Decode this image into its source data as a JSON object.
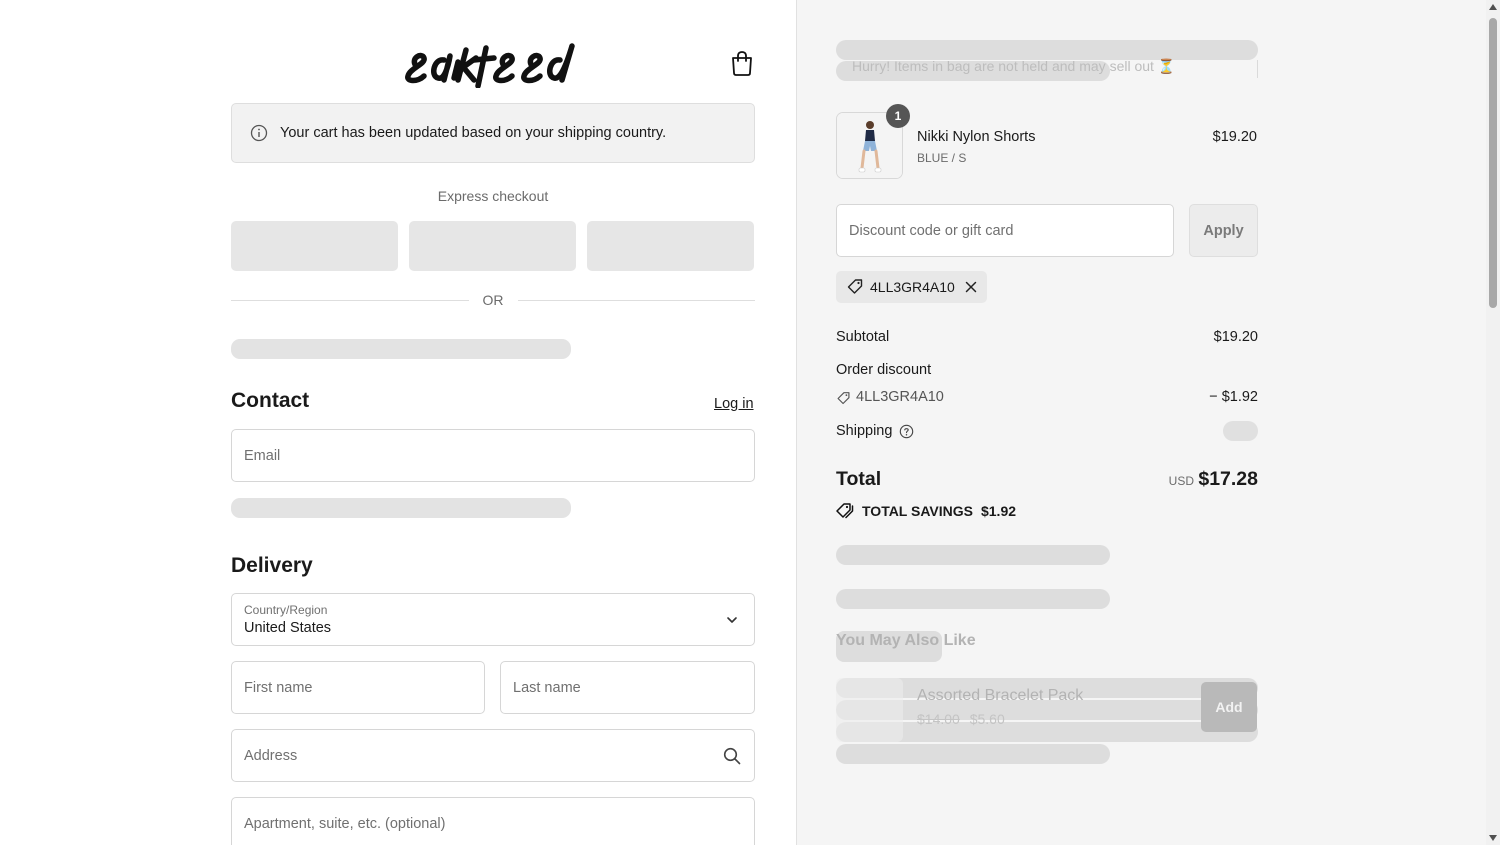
{
  "brand": {
    "logo_text": "edikted"
  },
  "notice": {
    "text": "Your cart has been updated based on your shipping country."
  },
  "express": {
    "label": "Express checkout",
    "or_label": "OR"
  },
  "contact": {
    "title": "Contact",
    "login_label": "Log in",
    "email_placeholder": "Email"
  },
  "delivery": {
    "title": "Delivery",
    "country_label": "Country/Region",
    "country_value": "United States",
    "first_name_placeholder": "First name",
    "last_name_placeholder": "Last name",
    "address_placeholder": "Address",
    "apartment_placeholder": "Apartment, suite, etc. (optional)"
  },
  "summary": {
    "hurry_text": "Hurry! Items in bag are not held and may sell out ⏳",
    "item": {
      "quantity": "1",
      "name": "Nikki Nylon Shorts",
      "variant": "BLUE / S",
      "price": "$19.20"
    },
    "discount_placeholder": "Discount code or gift card",
    "apply_label": "Apply",
    "applied_code": "4LL3GR4A10",
    "subtotal_label": "Subtotal",
    "subtotal_value": "$19.20",
    "order_discount_label": "Order discount",
    "order_discount_code": "4LL3GR4A10",
    "order_discount_value": "− $1.92",
    "shipping_label": "Shipping",
    "total_label": "Total",
    "currency": "USD",
    "total_value": "$17.28",
    "savings_label": "TOTAL SAVINGS",
    "savings_value": "$1.92"
  },
  "recommendations": {
    "title": "You May Also Like",
    "item_name": "Assorted Bracelet Pack",
    "old_price": "$14.00",
    "new_price": "$5.60",
    "add_label": "Add"
  },
  "icons": [
    "bag-icon",
    "info-icon",
    "chevron-down-icon",
    "search-icon",
    "tag-icon",
    "close-icon",
    "help-icon",
    "savings-tag-icon"
  ],
  "colors": {
    "panel_bg": "#f5f5f5",
    "skeleton": "#e3e3e3",
    "text": "#1a1a1a"
  }
}
